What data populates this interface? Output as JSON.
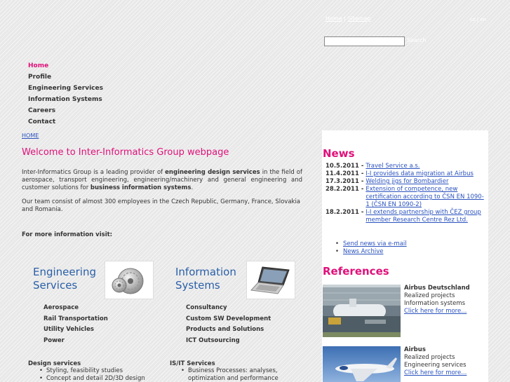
{
  "header": {
    "links": [
      "Home",
      "Sitemap"
    ],
    "separator": "|",
    "languages": [
      "cz",
      "en"
    ],
    "lang_separator": "|",
    "search": {
      "value": "",
      "button_label": "Search"
    }
  },
  "nav": {
    "items": [
      {
        "label": "Home",
        "active": true
      },
      {
        "label": "Profile",
        "active": false
      },
      {
        "label": "Engineering Services",
        "active": false
      },
      {
        "label": "Information Systems",
        "active": false
      },
      {
        "label": "Careers",
        "active": false
      },
      {
        "label": "Contact",
        "active": false
      }
    ]
  },
  "breadcrumb": "HOME",
  "main": {
    "welcome": "Welcome to Inter-Informatics Group webpage",
    "intro_1": "Inter-Informatics Group is a leading provider of ",
    "intro_b1": "engineering design services",
    "intro_2": " in the field of aerospace, transport engineering, engineering/machinery and general engineering and customer solutions for ",
    "intro_b2": "business information systems",
    "intro_3": ".",
    "team": "Our team consist of almost 300 employees in the Czech Republic, Germany, France, Slovakia and Romania.",
    "more": "For more information visit:",
    "eng_title_1": "Engineering",
    "eng_title_2": "Services",
    "is_title_1": "Information",
    "is_title_2": "Systems",
    "eng_list": [
      "Aerospace",
      "Rail Transportation",
      "Utility Vehicles",
      "Power"
    ],
    "is_list": [
      "Consultancy",
      "Custom SW Development",
      "Products and Solutions",
      "ICT Outsourcing"
    ],
    "design_head": "Design services",
    "design_items": [
      "Styling, feasibility studies",
      "Concept and detail 2D/3D design"
    ],
    "isit_head": "IS/IT Services",
    "isit_items": [
      "Business Processes: analyses, optimization and performance"
    ]
  },
  "news": {
    "title": "News",
    "items": [
      {
        "date": "10.5.2011 -",
        "text": "Travel Service a.s."
      },
      {
        "date": "11.4.2011 -",
        "text": "I-I provides data migration at Airbus"
      },
      {
        "date": "17.3.2011 -",
        "text": "Welding jigs for Bombardier"
      },
      {
        "date": "28.2.2011 -",
        "text": "Extension of competence, new certification according to ČSN EN 1090-1 (ČSN EN 1090-2)"
      },
      {
        "date": "18.2.2011 -",
        "text": "I-I extends partnership with ČEZ group member Research Centre Rez Ltd."
      }
    ],
    "links": [
      "Send news via e-mail",
      "News Archive"
    ]
  },
  "references": {
    "title": "References",
    "items": [
      {
        "name": "Airbus Deutschland",
        "line1": "Realized projects",
        "line2": "Information systems",
        "link": "Click here for more..."
      },
      {
        "name": "Airbus",
        "line1": "Realized projects",
        "line2": "Engineering services",
        "link": "Click here for more..."
      }
    ]
  }
}
